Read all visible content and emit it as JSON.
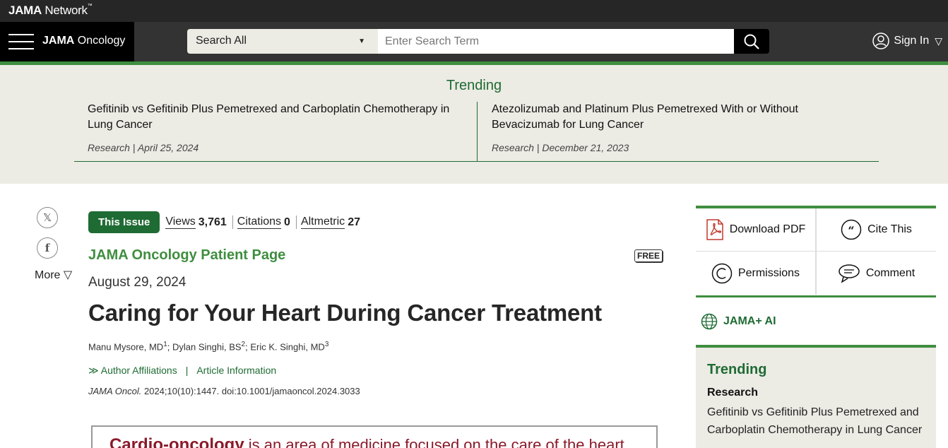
{
  "network": {
    "brand_bold": "JAMA",
    "brand_rest": " Network",
    "tm": "™"
  },
  "header": {
    "journal_bold": "JAMA",
    "journal_rest": " Oncology",
    "search_scope": "Search All",
    "search_placeholder": "Enter Search Term",
    "signin_label": "Sign In"
  },
  "trending": {
    "title": "Trending",
    "items": [
      {
        "title": "Gefitinib vs Gefitinib Plus Pemetrexed and Carboplatin Chemotherapy in Lung Cancer",
        "meta": "Research | April 25, 2024"
      },
      {
        "title": "Atezolizumab and Platinum Plus Pemetrexed With or Without Bevacizumab for Lung Cancer",
        "meta": "Research | December 21, 2023"
      }
    ]
  },
  "social": {
    "more_label": "More"
  },
  "article": {
    "issue_label": "This Issue",
    "views_label": "Views",
    "views_value": "3,761",
    "citations_label": "Citations",
    "citations_value": "0",
    "altmetric_label": "Altmetric",
    "altmetric_value": "27",
    "section": "JAMA Oncology Patient Page",
    "free_badge": "FREE",
    "date": "August 29, 2024",
    "title": "Caring for Your Heart During Cancer Treatment",
    "author1": "Manu Mysore, MD",
    "author1_sup": "1",
    "author2": "; Dylan Singhi, BS",
    "author2_sup": "2",
    "author3": "; Eric K. Singhi, MD",
    "author3_sup": "3",
    "affiliations_link": "Author Affiliations",
    "article_info_link": "Article Information",
    "citation_journal": "JAMA Oncol.",
    "citation_rest": " 2024;10(10):1447. doi:10.1001/jamaoncol.2024.3033",
    "callout_highlight": "Cardio-oncology",
    "callout_rest": " is an area of medicine focused on the care of the heart"
  },
  "tools": {
    "download_pdf": "Download PDF",
    "cite_this": "Cite This",
    "permissions": "Permissions",
    "comment": "Comment"
  },
  "ai_link": "JAMA+ AI",
  "side_trending": {
    "title": "Trending",
    "category": "Research",
    "item_title": "Gefitinib vs Gefitinib Plus Pemetrexed and Carboplatin Chemotherapy in Lung Cancer"
  },
  "colors": {
    "accent_green": "#1f6b34",
    "rule_green": "#3f8e3f",
    "band_bg": "#ecebe4"
  }
}
